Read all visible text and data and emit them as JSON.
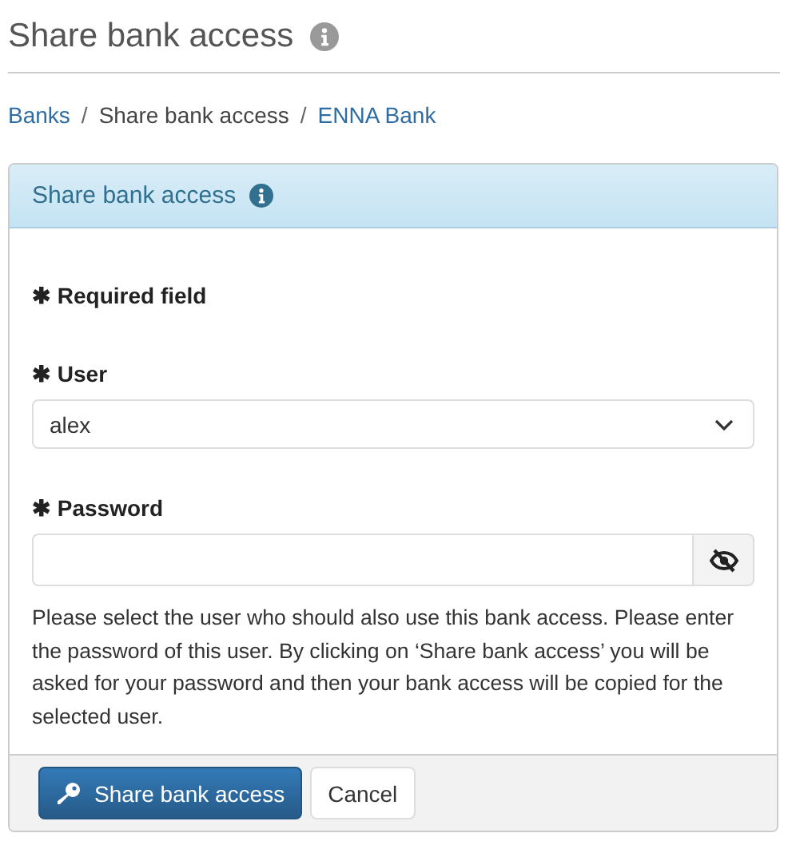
{
  "page": {
    "title": "Share bank access"
  },
  "breadcrumb": [
    {
      "kind": "link",
      "text": "Banks"
    },
    {
      "kind": "separator",
      "text": "/"
    },
    {
      "kind": "text",
      "text": "Share bank access"
    },
    {
      "kind": "separator",
      "text": "/"
    },
    {
      "kind": "link",
      "text": "ENNA Bank"
    }
  ],
  "panel": {
    "title": "Share bank access",
    "required_note": "✱ Required field",
    "fields": [
      {
        "kind": "select",
        "label": "✱ User",
        "value": "alex"
      },
      {
        "kind": "password",
        "label": "✱ Password"
      }
    ],
    "help": "Please select the user who should also use this bank access. Please enter the password of this user. By clicking on ‘Share bank access’ you will be asked for your password and then your bank access will be copied for the selected user.",
    "buttons": [
      {
        "kind": "primary",
        "label": "Share bank access"
      },
      {
        "kind": "default",
        "label": "Cancel"
      }
    ]
  }
}
